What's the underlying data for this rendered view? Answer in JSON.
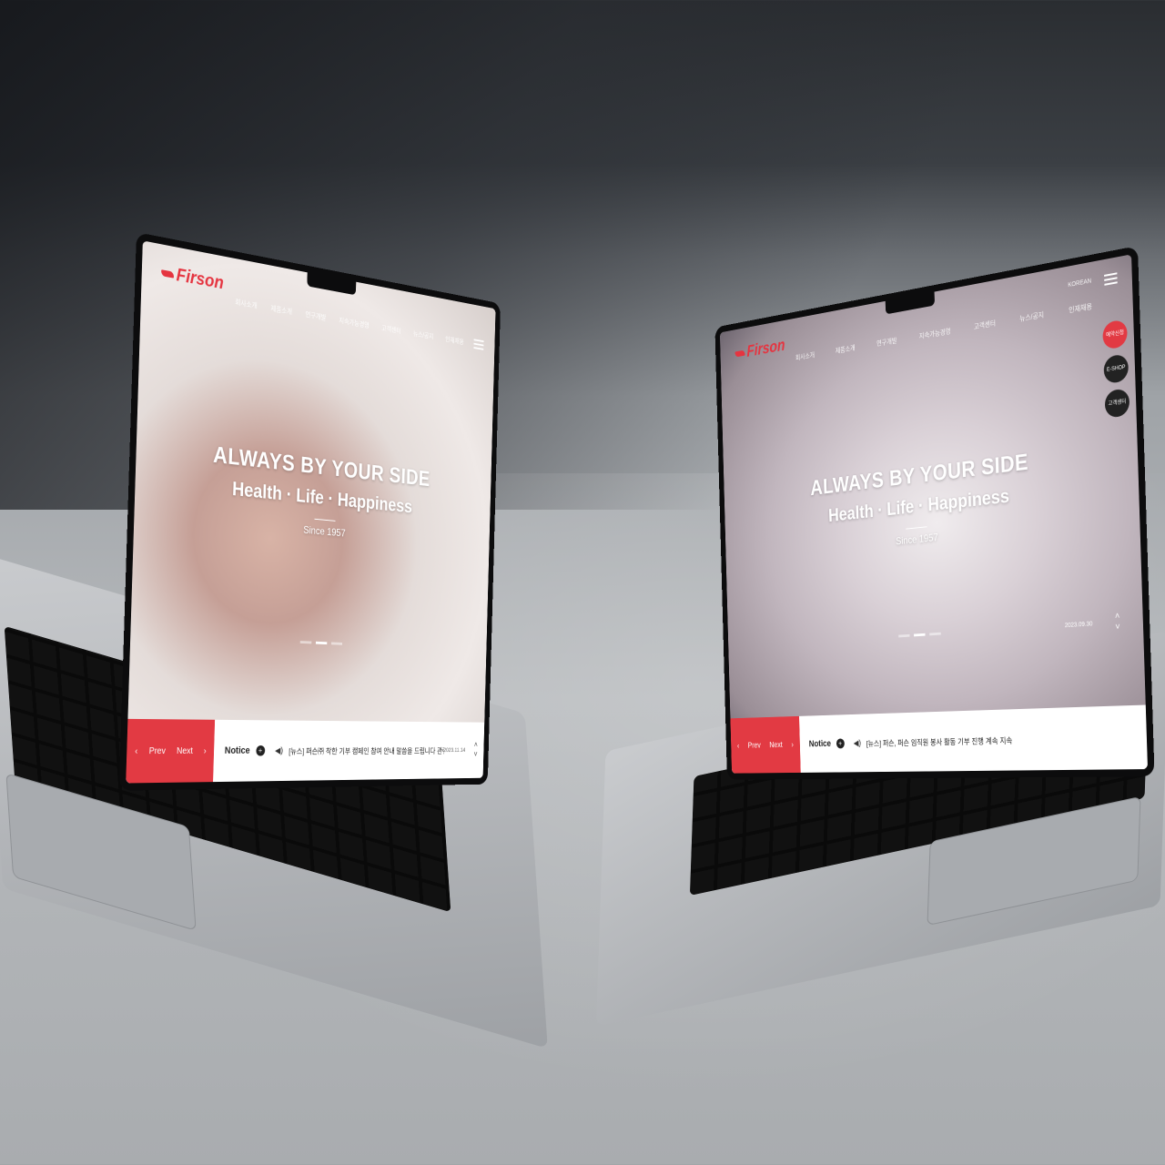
{
  "brand": {
    "name": "Firson",
    "accent": "#e23a43"
  },
  "nav": [
    "회사소개",
    "제품소개",
    "연구개발",
    "지속가능경영",
    "고객센터",
    "뉴스/공지",
    "인재채용"
  ],
  "hero": {
    "line1": "ALWAYS BY YOUR SIDE",
    "line2": "Health · Life · Happiness",
    "line3": "Since 1957"
  },
  "bar": {
    "prev": "Prev",
    "next": "Next",
    "notice": "Notice",
    "plus": "+",
    "speaker": "◀)"
  },
  "left": {
    "notice_text": "[뉴스] 퍼슨㈜ 착한 기부 캠페인 참여 안내 말씀을 드립니다 관련 공지",
    "date": "2023.11.14"
  },
  "right": {
    "notice_text": "[뉴스] 퍼슨, 퍼슨 임직원 봉사 활동 기부 진행 계속 지속",
    "date": "2023.09.30",
    "lang": "KOREAN",
    "side": [
      "예약신청",
      "E-SHOP",
      "고객센터"
    ]
  }
}
